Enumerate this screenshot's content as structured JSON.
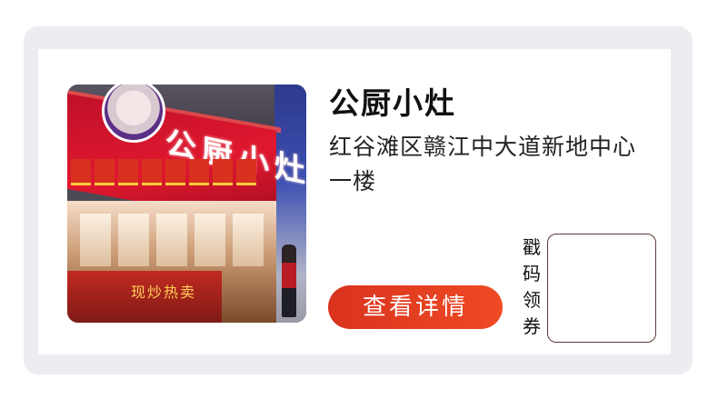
{
  "store": {
    "name": "公厨小灶",
    "address": "红谷滩区赣江中大道新地中心一楼",
    "photo_sign_text": "公厨小灶",
    "photo_counter_text": "现炒热卖"
  },
  "actions": {
    "detail_label": "查看详情"
  },
  "coupon": {
    "stamp_label_chars": [
      "戳",
      "码",
      "领",
      "券"
    ]
  },
  "colors": {
    "frame": "#ececf1",
    "button": "#e8401f",
    "stamp_border": "#5b3a36"
  }
}
